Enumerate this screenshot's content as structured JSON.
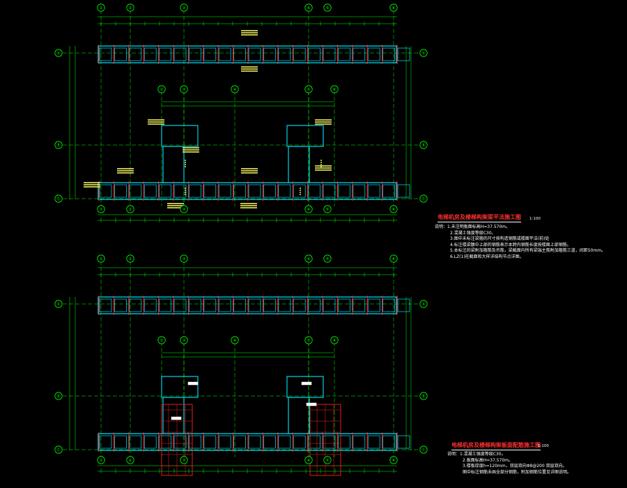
{
  "colors": {
    "background": "#000000",
    "axis": "#00ff00",
    "wall": "#00e5ff",
    "dim": "#ffff66",
    "beam": "#ff2020",
    "text": "#ffffff",
    "title": "#ff3030",
    "bubble": "#00ff00"
  },
  "plan_top": {
    "title": "电梯机房及楼梯构架梁平法施工图",
    "scale": "1:100",
    "notes_label": "说明：",
    "notes": [
      "1.未注明板面标高H=37.570m。",
      "2.混凝土强度等级C30。",
      "3.图中未标注梁箍的尺寸按构造钢筋或楼面平法(前)处",
      "4.标注楼梁腰中上部的钢筋表示本跨内钢筋长度按楼面上部钢筋。",
      "5.本标注的梁附加箍筋及吊筋，梁截面内所有梁端主筋附加箍筋三道，间距50mm。",
      "6.LZ(1)柱截面和大样详结构节点详图。"
    ],
    "axis_labels_top": [
      "①",
      "②",
      "③",
      "④",
      "⑤",
      "⑥",
      "⑦"
    ],
    "axis_labels_left": [
      "Ⓐ",
      "Ⓑ",
      "Ⓒ"
    ]
  },
  "plan_bottom": {
    "title": "电梯机房及楼梯构架板面配筋施工图",
    "scale": "1:100",
    "notes_label": "说明：",
    "notes": [
      "1.混凝土强度等级C30。",
      "2.板面标高H=37.570m。",
      "3.楼板厚度h=120mm，双层双向Φ8@200 双层双向。",
      "图中标注钢筋未画全部分钢筋，附加钢筋位置见详图说明。"
    ],
    "axis_labels_top": [
      "①",
      "②",
      "③",
      "④",
      "⑤",
      "⑥",
      "⑦"
    ],
    "axis_labels_left": [
      "Ⓐ",
      "Ⓑ",
      "Ⓒ"
    ]
  }
}
